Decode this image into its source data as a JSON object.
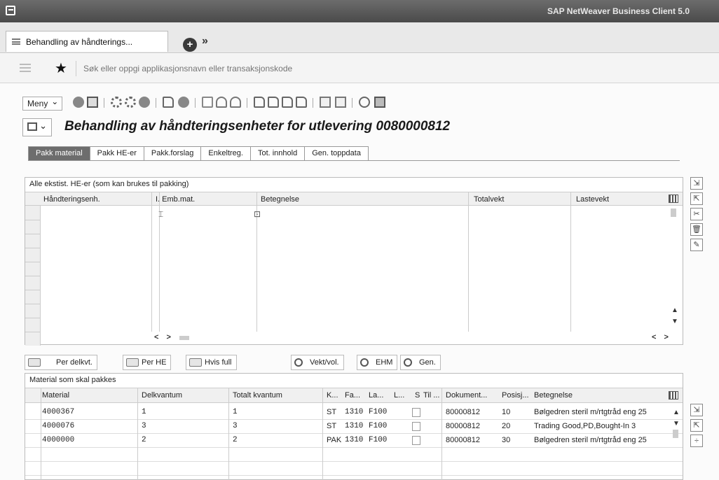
{
  "window": {
    "product_name": "SAP NetWeaver Business Client 5.0"
  },
  "session_tab": {
    "label": "Behandling av håndterings..."
  },
  "search": {
    "placeholder": "Søk eller oppgi applikasjonsnavn eller transaksjonskode"
  },
  "toolbar": {
    "menu_label": "Meny"
  },
  "page": {
    "title": "Behandling av håndteringsenheter for utlevering 0080000812"
  },
  "tabs": [
    "Pakk material",
    "Pakk HE-er",
    "Pakk.forslag",
    "Enkeltreg.",
    "Tot. innhold",
    "Gen. toppdata"
  ],
  "upper_grid": {
    "caption": "Alle ekstist. HE-er (som kan brukes til pakking)",
    "columns": [
      "Håndteringsenh.",
      "I. Emb.mat.",
      "Betegnelse",
      "Totalvekt",
      "Lastevekt"
    ],
    "nav": "< >"
  },
  "lower_toolbar": {
    "per_delkvt": "Per delkvt.",
    "per_he": "Per HE",
    "hvis_full": "Hvis full",
    "vekt_vol": "Vekt/vol.",
    "ehm": "EHM",
    "gen": "Gen."
  },
  "lower_grid": {
    "caption": "Material som skal pakkes",
    "columns": [
      "Material",
      "Delkvantum",
      "Totalt kvantum",
      "K...",
      "Fa...",
      "La...",
      "L...",
      "S",
      "Til ...",
      "Dokument...",
      "Posisj...",
      "Betegnelse"
    ],
    "rows": [
      {
        "material": "4000367",
        "delkvantum": "1",
        "totalt": "1",
        "k": "ST",
        "fa": "1310",
        "la": "F100",
        "dokument": "80000812",
        "posisjon": "10",
        "betegnelse": "Bølgedren steril m/rtgtråd eng 25"
      },
      {
        "material": "4000076",
        "delkvantum": "3",
        "totalt": "3",
        "k": "ST",
        "fa": "1310",
        "la": "F100",
        "dokument": "80000812",
        "posisjon": "20",
        "betegnelse": "Trading Good,PD,Bought-In 3"
      },
      {
        "material": "4000000",
        "delkvantum": "2",
        "totalt": "2",
        "k": "PAK",
        "fa": "1310",
        "la": "F100",
        "dokument": "80000812",
        "posisjon": "30",
        "betegnelse": "Bølgedren steril m/rtgtråd eng 25"
      }
    ]
  }
}
